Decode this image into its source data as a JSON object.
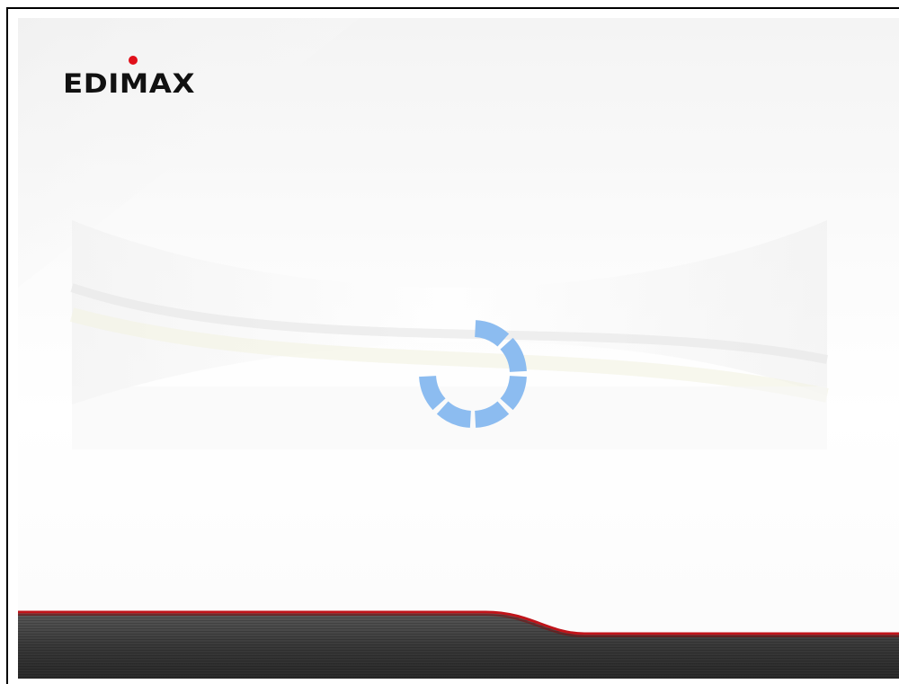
{
  "brand": {
    "logo_text": "EDIMAX",
    "logo_color": "#111111",
    "accent_dot_color": "#e0101a"
  },
  "loading": {
    "spinner_color": "#8cbcf0",
    "segments_total": 8,
    "segments_visible": 6
  },
  "footer": {
    "band_color": "#3a3a3a",
    "accent_line_color": "#c0141a"
  }
}
